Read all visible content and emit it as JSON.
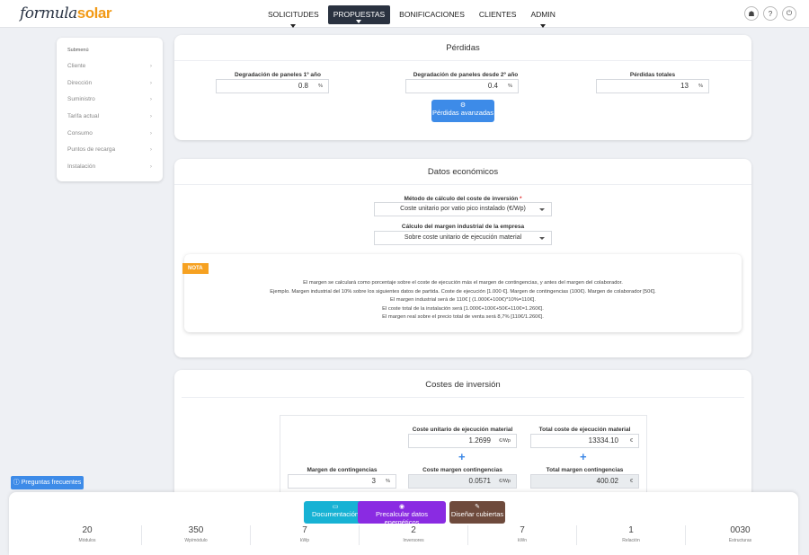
{
  "app": {
    "brand_prefix": "formula",
    "brand_suffix": "solar"
  },
  "nav": {
    "items": [
      "SOLICITUDES",
      "PROPUESTAS",
      "BONIFICACIONES",
      "CLIENTES",
      "ADMIN"
    ],
    "active": "PROPUESTAS"
  },
  "top_icons": [
    "user-icon",
    "help-icon",
    "power-icon"
  ],
  "submenu": {
    "title": "Submenú",
    "items": [
      "Cliente",
      "Dirección",
      "Suministro",
      "Tarifa actual",
      "Consumo",
      "Puntos de recarga",
      "Instalación"
    ]
  },
  "perdidas": {
    "title": "Pérdidas",
    "deg_first_label": "Degradación de paneles 1º año",
    "deg_first_value": "0.8",
    "deg_second_label": "Degradación de paneles desde 2º año",
    "deg_second_value": "0.4",
    "total_label": "Pérdidas totales",
    "total_value": "13",
    "unit": "%",
    "advanced_button": "Pérdidas avanzadas"
  },
  "economicos": {
    "title": "Datos económicos",
    "method_label": "Método de cálculo del coste de inversión",
    "required_mark": "*",
    "method_value": "Coste unitario por vatio pico instalado (€/Wp)",
    "margin_label": "Cálculo del margen industrial de la empresa",
    "margin_value": "Sobre coste unitario de ejecución material",
    "nota_badge": "NOTA",
    "nota_lines": [
      "El margen se calculará como porcentaje sobre el coste de ejecución más el margen de contingencias, y antes del margen del colaborador.",
      "Ejemplo. Margen industrial del 10% sobre los siguientes datos de partida. Coste de ejecución [1.000 €]. Margen de contingencias (100€). Margen de colaborador [50€].",
      "El margen industrial será de 110€ [ (1.000€+100€)*10%=110€].",
      "El coste total de la instalación será [1.000€+100€+50€+110€=1.260€].",
      "El margen real sobre el precio total de venta será 8,7% [110€/1.260€]."
    ]
  },
  "costes": {
    "title": "Costes de inversión",
    "unit_cost_label": "Coste unitario de ejecución material",
    "unit_cost_value": "1.2699",
    "unit_cost_unit": "€/Wp",
    "total_cost_label": "Total coste de ejecución material",
    "total_cost_value": "13334.10",
    "total_cost_unit": "€",
    "contingency_label": "Margen de contingencias",
    "contingency_value": "3",
    "contingency_unit": "%",
    "unit_contingency_label": "Coste margen contingencias",
    "unit_contingency_value": "0.0571",
    "unit_contingency_unit": "€/Wp",
    "total_contingency_label": "Total margen contingencias",
    "total_contingency_value": "400.02",
    "total_contingency_unit": "€"
  },
  "help": {
    "faq_button": "Preguntas frecuentes"
  },
  "bottom": {
    "buttons": {
      "documentacion": "Documentación",
      "precalcular": "Precalcular datos energéticos",
      "disenar": "Diseñar cubiertas"
    },
    "colors": {
      "documentacion": "#17b2d4",
      "precalcular": "#8a2be2",
      "disenar": "#6e4a3c"
    },
    "stats": [
      {
        "value": "20",
        "label": "Módulos"
      },
      {
        "value": "350",
        "label": "Wp/módulo"
      },
      {
        "value": "7",
        "label": "kWp"
      },
      {
        "value": "2",
        "label": "Inversores"
      },
      {
        "value": "7",
        "label": "kWn"
      },
      {
        "value": "1",
        "label": "Relación"
      },
      {
        "value": "0030",
        "label": "Estructuras"
      }
    ]
  }
}
